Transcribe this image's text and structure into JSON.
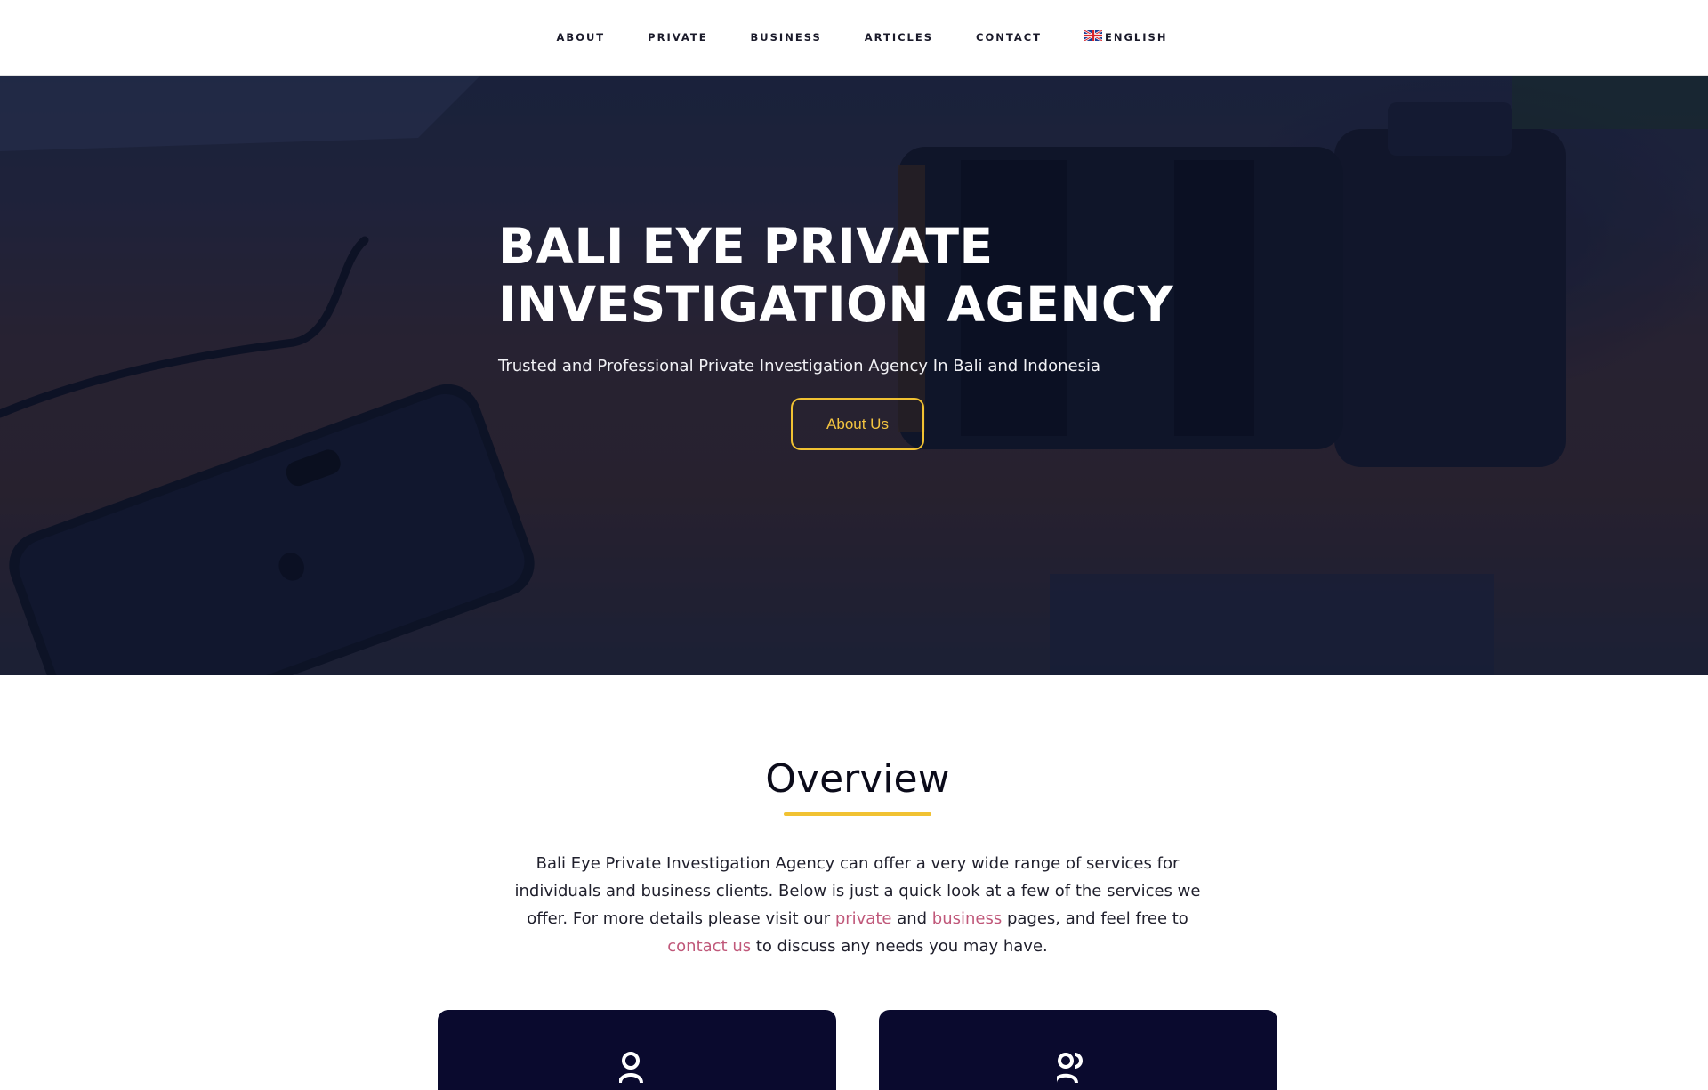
{
  "nav": {
    "items": [
      {
        "label": "ABOUT"
      },
      {
        "label": "PRIVATE"
      },
      {
        "label": "BUSINESS"
      },
      {
        "label": "ARTICLES"
      },
      {
        "label": "CONTACT"
      }
    ],
    "language": {
      "label": "ENGLISH",
      "icon": "uk-flag-icon"
    }
  },
  "hero": {
    "title_line1": "BALI EYE PRIVATE",
    "title_line2": "INVESTIGATION AGENCY",
    "subtitle": "Trusted and Professional Private Investigation Agency In Bali and Indonesia",
    "button_label": "About Us",
    "accent_color": "#f1c232"
  },
  "overview": {
    "title": "Overview",
    "text_1": "Bali Eye Private Investigation Agency can offer a very wide range of services for individuals and business clients. Below is just a quick look at a few of the services we offer. For more details please visit our ",
    "link_private": "private",
    "text_2": " and ",
    "link_business": "business",
    "text_3": " pages, and feel free to ",
    "link_contact": "contact us",
    "text_4": " to discuss any needs you may have.",
    "link_color": "#c0587a"
  },
  "cards": [
    {
      "icon": "person-icon",
      "color": "#0a0a2e"
    },
    {
      "icon": "people-icon",
      "color": "#0a0a2e"
    }
  ]
}
